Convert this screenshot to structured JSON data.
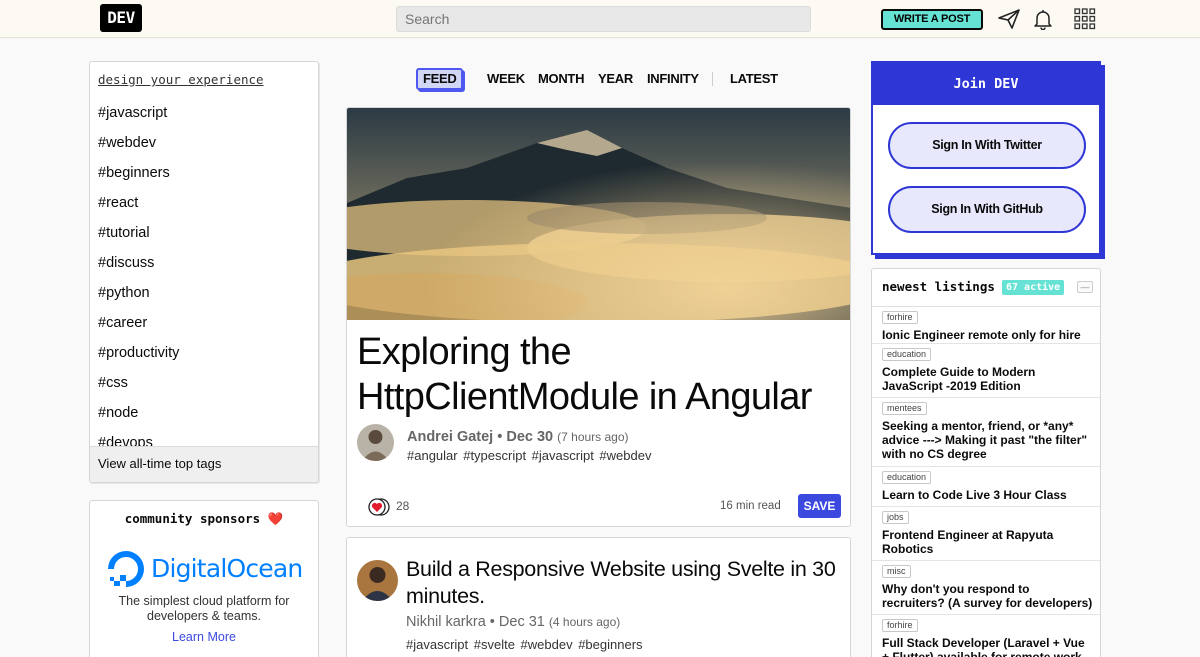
{
  "header": {
    "logo": "DEV",
    "search_placeholder": "Search",
    "write_post": "WRITE A POST",
    "icons": [
      "send-icon",
      "bell-icon",
      "apps-grid-icon"
    ]
  },
  "sidebar": {
    "title": "design your experience",
    "tags": [
      "#javascript",
      "#webdev",
      "#beginners",
      "#react",
      "#tutorial",
      "#discuss",
      "#python",
      "#career",
      "#productivity",
      "#css",
      "#node",
      "#devops"
    ],
    "footer": "View all-time top tags"
  },
  "sponsors": {
    "title": "community sponsors",
    "heart": "❤️",
    "brand": "DigitalOcean",
    "tagline": "The simplest cloud platform for developers & teams.",
    "link": "Learn More"
  },
  "tabs": {
    "items": [
      "FEED",
      "WEEK",
      "MONTH",
      "YEAR",
      "INFINITY",
      "LATEST"
    ],
    "active": "FEED"
  },
  "featured": {
    "title": "Exploring the HttpClientModule in Angular",
    "author": "Andrei Gatej",
    "date": "Dec 30",
    "relative": "(7 hours ago)",
    "tags": "#angular #typescript #javascript #webdev",
    "reactions": "28",
    "read_time": "16 min read",
    "save": "SAVE"
  },
  "second_post": {
    "title": "Build a Responsive Website using Svelte in 30 minutes.",
    "author": "Nikhil karkra",
    "date": "Dec 31",
    "relative": "(4 hours ago)",
    "tags": "#javascript #svelte #webdev #beginners"
  },
  "join": {
    "title": "Join DEV",
    "twitter": "Sign In With Twitter",
    "github": "Sign In With GitHub"
  },
  "listings": {
    "title": "newest listings",
    "badge": "67 active",
    "collapse": "—",
    "items": [
      {
        "category": "forhire",
        "title": "Ionic Engineer remote only for hire"
      },
      {
        "category": "education",
        "title": "Complete Guide to Modern JavaScript -2019 Edition"
      },
      {
        "category": "mentees",
        "title": "Seeking a mentor, friend, or *any* advice ---> Making it past \"the filter\" with no CS degree"
      },
      {
        "category": "education",
        "title": "Learn to Code Live 3 Hour Class"
      },
      {
        "category": "jobs",
        "title": "Frontend Engineer at Rapyuta Robotics"
      },
      {
        "category": "misc",
        "title": "Why don't you respond to recruiters? (A survey for developers)"
      },
      {
        "category": "forhire",
        "title": "Full Stack Developer (Laravel + Vue + Flutter) available for remote work"
      }
    ]
  },
  "colors": {
    "accent": "#3b49df",
    "join_blue": "#2f36d6",
    "teal": "#66e2d5",
    "do_blue": "#0080ff"
  }
}
